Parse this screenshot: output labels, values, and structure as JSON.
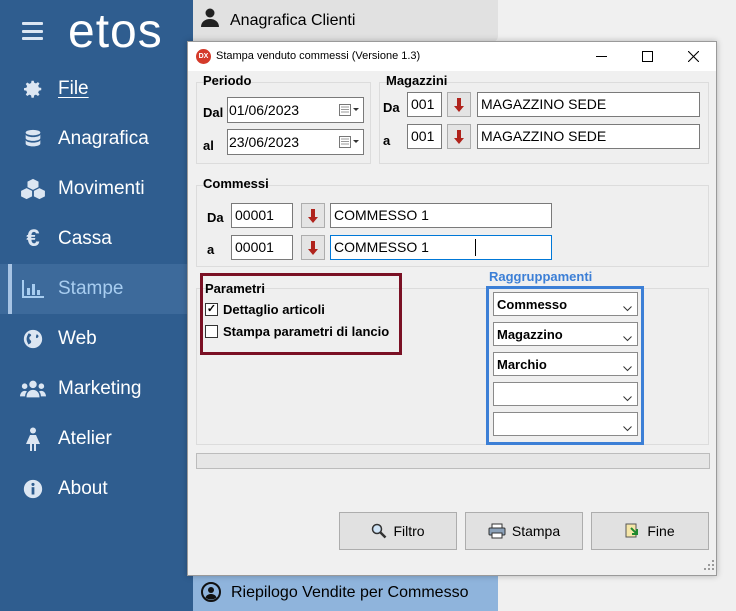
{
  "sidebar": {
    "logo": "etos",
    "items": [
      {
        "label": "File",
        "icon": "gear-icon"
      },
      {
        "label": "Anagrafica",
        "icon": "database-icon"
      },
      {
        "label": "Movimenti",
        "icon": "cubes-icon"
      },
      {
        "label": "Cassa",
        "icon": "euro-icon"
      },
      {
        "label": "Stampe",
        "icon": "bar-chart-icon",
        "active": true
      },
      {
        "label": "Web",
        "icon": "globe-icon"
      },
      {
        "label": "Marketing",
        "icon": "users-icon"
      },
      {
        "label": "Atelier",
        "icon": "woman-icon"
      },
      {
        "label": "About",
        "icon": "info-icon"
      }
    ],
    "accent": "#2f5d8f"
  },
  "background_tabs": {
    "top": "Anagrafica Clienti",
    "bottom": "Riepilogo Vendite per Commesso"
  },
  "dialog": {
    "title": "Stampa venduto commessi (Versione 1.3)",
    "app_icon_text": "DX",
    "periodo": {
      "title": "Periodo",
      "dal_label": "Dal",
      "dal_value": "01/06/2023",
      "al_label": "al",
      "al_value": "23/06/2023"
    },
    "magazzini": {
      "title": "Magazzini",
      "da_label": "Da",
      "da_code": "001",
      "da_name": "MAGAZZINO SEDE",
      "a_label": "a",
      "a_code": "001",
      "a_name": "MAGAZZINO SEDE"
    },
    "commessi": {
      "title": "Commessi",
      "da_label": "Da",
      "da_code": "00001",
      "da_name": "COMMESSO 1",
      "a_label": "a",
      "a_code": "00001",
      "a_name": "COMMESSO 1"
    },
    "parametri": {
      "title": "Parametri",
      "options": [
        {
          "label": "Dettaglio articoli",
          "checked": true
        },
        {
          "label": "Stampa parametri di lancio",
          "checked": false
        }
      ],
      "highlight_color": "#7a1024"
    },
    "raggruppamenti": {
      "title": "Raggruppamenti",
      "combos": [
        "Commesso",
        "Magazzino",
        "Marchio",
        "",
        ""
      ],
      "highlight_color": "#3c7fd6"
    },
    "buttons": {
      "filtro": "Filtro",
      "stampa": "Stampa",
      "fine": "Fine"
    }
  }
}
